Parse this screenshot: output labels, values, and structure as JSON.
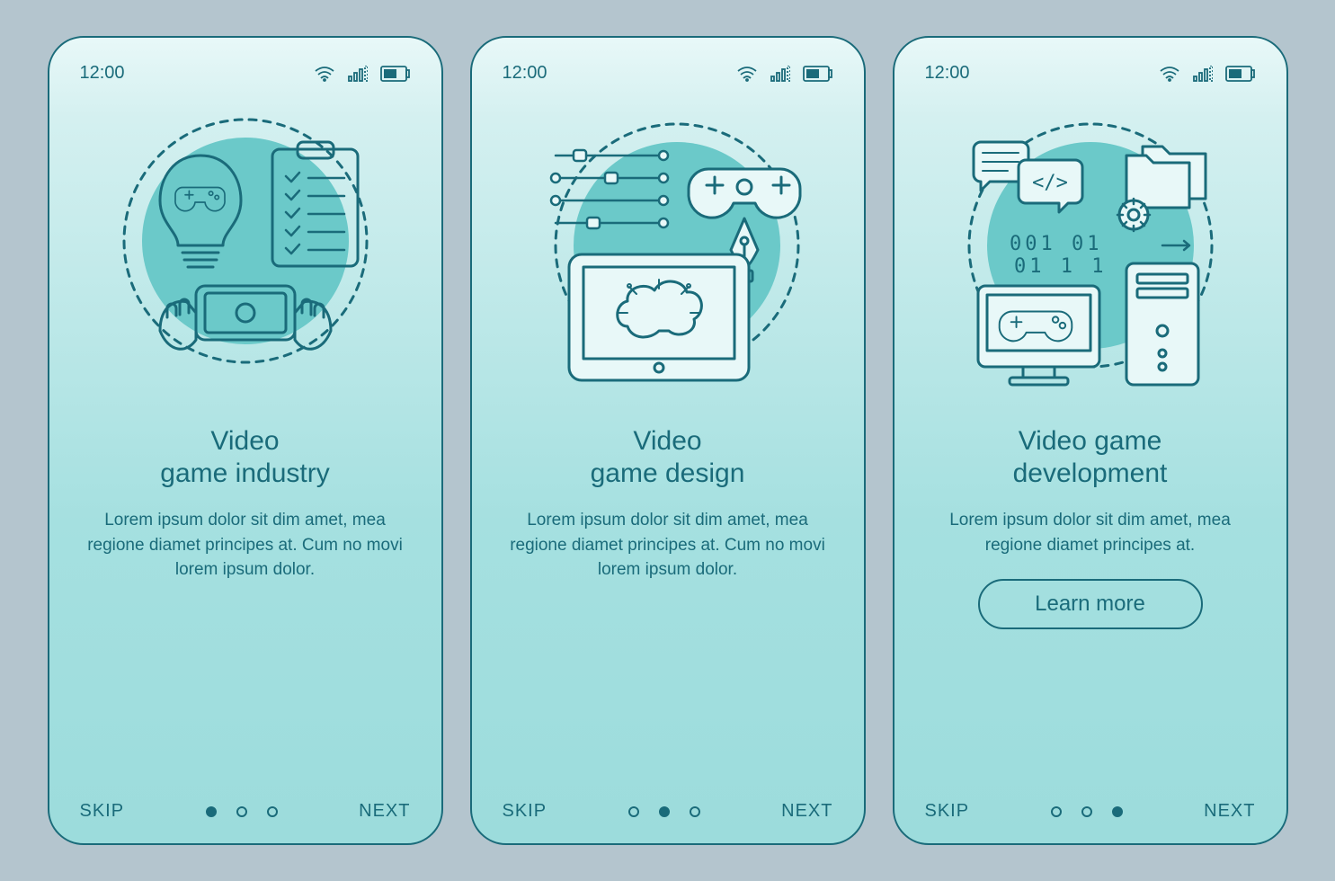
{
  "statusBar": {
    "time": "12:00"
  },
  "colors": {
    "stroke": "#1a6b7a",
    "accent": "#6bc9c9",
    "bgLight": "#e8f8f8"
  },
  "screens": [
    {
      "title": "Video\ngame industry",
      "description": "Lorem ipsum dolor sit dim amet, mea regione diamet principes at. Cum no movi lorem ipsum dolor.",
      "skip": "SKIP",
      "next": "NEXT",
      "activeDot": 0,
      "learnMore": null
    },
    {
      "title": "Video\ngame design",
      "description": "Lorem ipsum dolor sit dim amet, mea regione diamet principes at. Cum no movi lorem ipsum dolor.",
      "skip": "SKIP",
      "next": "NEXT",
      "activeDot": 1,
      "learnMore": null
    },
    {
      "title": "Video game\ndevelopment",
      "description": "Lorem ipsum dolor sit dim amet, mea regione diamet principes at.",
      "skip": "SKIP",
      "next": "NEXT",
      "activeDot": 2,
      "learnMore": "Learn more"
    }
  ]
}
